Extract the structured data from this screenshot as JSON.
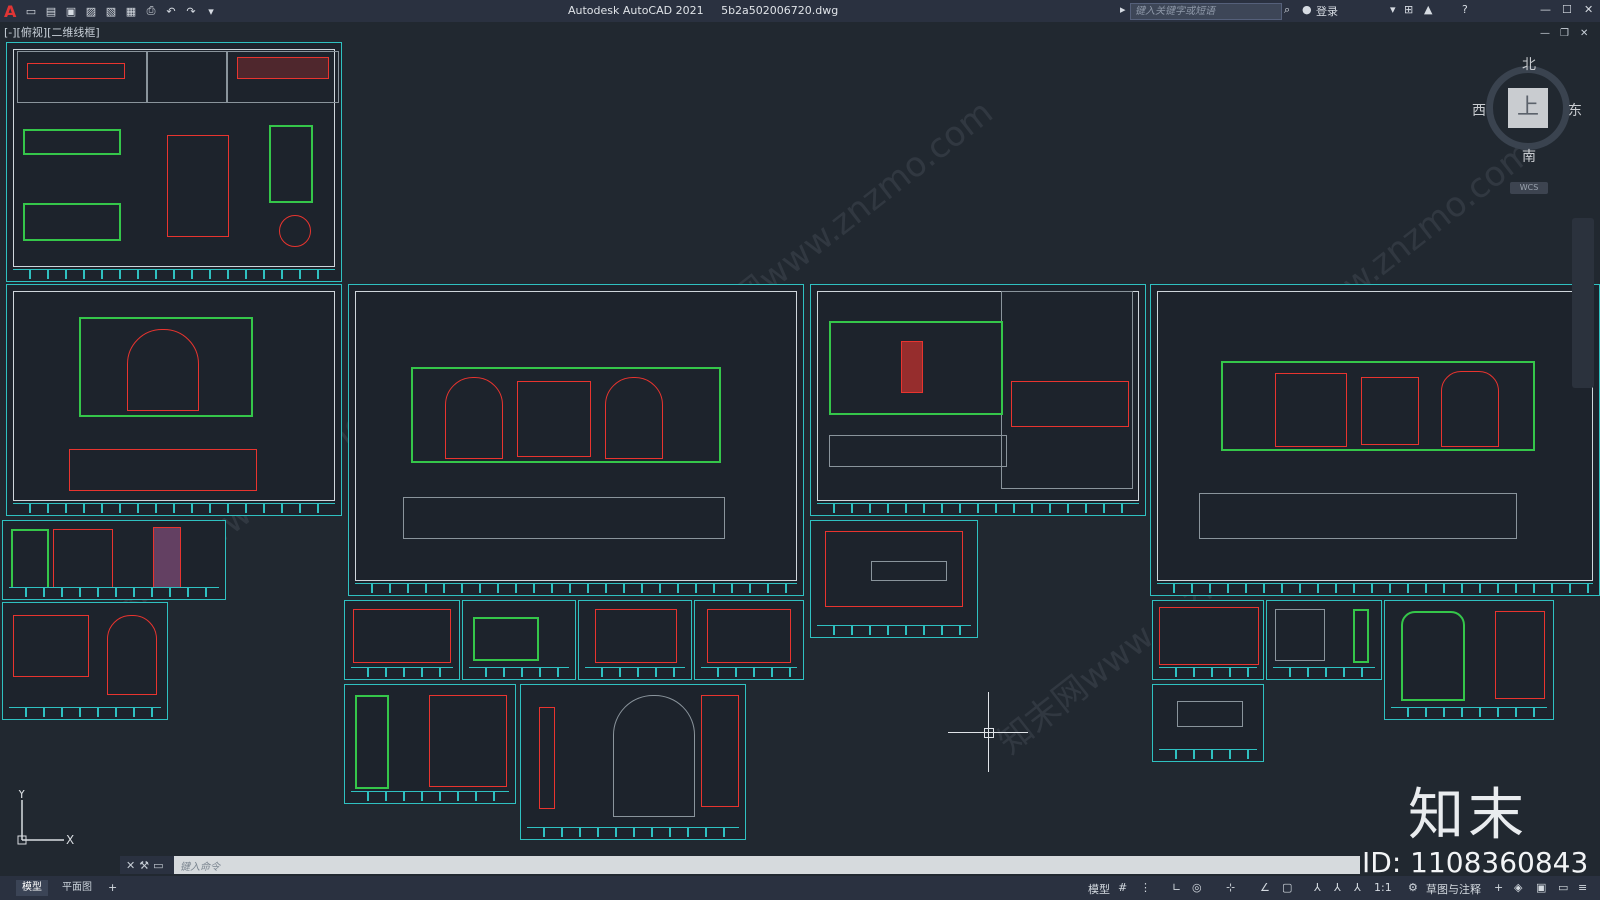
{
  "app": {
    "title": "Autodesk AutoCAD 2021",
    "filename": "5b2a502006720.dwg"
  },
  "toolbar": {
    "search_placeholder": "键入关键字或短语",
    "login_label": "登录"
  },
  "viewport": {
    "label": "[-][俯视][二维线框]"
  },
  "viewcube": {
    "north": "北",
    "south": "南",
    "east": "东",
    "west": "西",
    "face": "上",
    "wcs": "WCS"
  },
  "command": {
    "placeholder": "键入命令"
  },
  "layout_tabs": [
    {
      "label": "模型",
      "active": true
    },
    {
      "label": "平面图",
      "active": false
    }
  ],
  "status_bar": {
    "model_label": "模型",
    "scale": "1:1",
    "annotation": "草图与注释"
  },
  "watermark": {
    "text": "知末网www.znzmo.com",
    "brand": "知末",
    "id_text": "ID: 1108360843"
  },
  "colors": {
    "background": "#212830",
    "frame": "#2fc1c1",
    "drawing_red": "#e8342f",
    "drawing_green": "#35c64a"
  }
}
